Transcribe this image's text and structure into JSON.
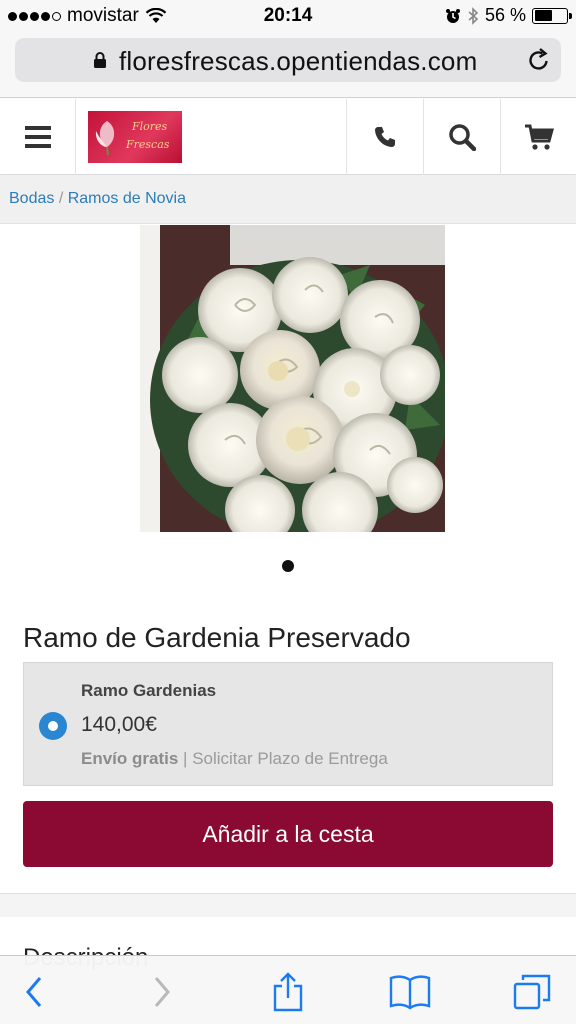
{
  "status_bar": {
    "carrier": "movistar",
    "time": "20:14",
    "battery": "56 %",
    "battery_level": 0.56,
    "signal_bars": 4
  },
  "browser": {
    "url": "floresfrescas.opentiendas.com"
  },
  "header": {
    "logo_line1": "Flores",
    "logo_line2": "Frescas",
    "icons": [
      "menu-icon",
      "phone-icon",
      "search-icon",
      "cart-icon"
    ]
  },
  "breadcrumb": {
    "items": [
      "Bodas",
      "Ramos de Novia"
    ],
    "separator": " / "
  },
  "product": {
    "title": "Ramo de Gardenia Preservado",
    "variant": {
      "name": "Ramo Gardenias",
      "price": "140,00€",
      "shipping_free": "Envío gratis",
      "shipping_separator": " | ",
      "shipping_link": "Solicitar Plazo de Entrega"
    },
    "add_to_cart_label": "Añadir a la cesta",
    "description_heading": "Descripción"
  },
  "colors": {
    "accent": "#8a0a33",
    "link": "#2a7db8",
    "radio": "#2a86d0"
  }
}
